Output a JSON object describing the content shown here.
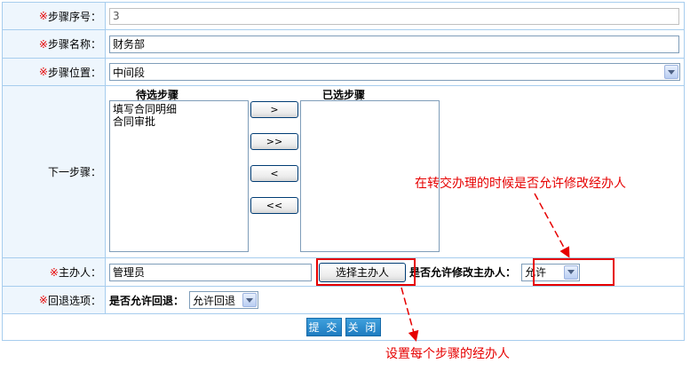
{
  "form": {
    "step_no": {
      "label": "步骤序号：",
      "required_mark": "※",
      "value": "3"
    },
    "step_name": {
      "label": "步骤名称：",
      "required_mark": "※",
      "value": "财务部"
    },
    "step_position": {
      "label": "步骤位置：",
      "required_mark": "※",
      "value": "中间段"
    },
    "next_step": {
      "label": "下一步骤：",
      "candidate_title": "待选步骤",
      "selected_title": "已选步骤",
      "candidates": [
        "填写合同明细",
        "合同审批"
      ],
      "move_right": ">",
      "move_all_right": ">>",
      "move_left": "<",
      "move_all_left": "<<"
    },
    "handler": {
      "label": "主办人：",
      "required_mark": "※",
      "value": "管理员",
      "select_button": "选择主办人",
      "allow_label": "是否允许修改主办人：",
      "allow_value": "允许"
    },
    "rollback": {
      "label": "回退选项：",
      "required_mark": "※",
      "allow_label": "是否允许回退：",
      "allow_value": "允许回退"
    },
    "submit": "提 交",
    "close": "关 闭"
  },
  "annotations": {
    "top": "在转交办理的时候是否允许修改经办人",
    "bottom": "设置每个步骤的经办人"
  },
  "colors": {
    "border": "#a7cdee",
    "label_bg": "#eef6fd",
    "required": "#e60000",
    "annotation": "#e60000",
    "button_blue": "#2a8ccf"
  }
}
